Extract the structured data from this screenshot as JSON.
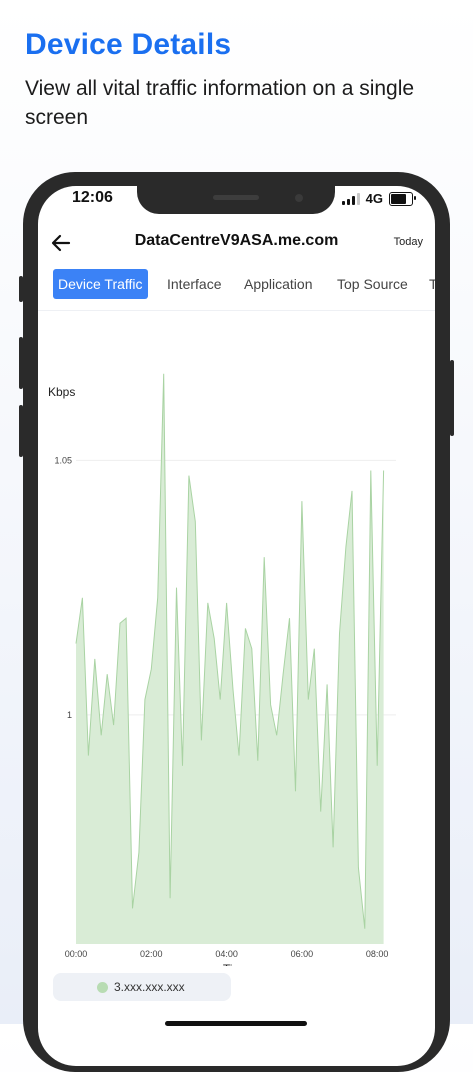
{
  "headline": "Device Details",
  "subhead": "View all vital traffic information on a single screen",
  "status": {
    "time": "12:06",
    "network": "4G"
  },
  "header": {
    "title": "DataCentreV9ASA.me.com",
    "range": "Today"
  },
  "tabs": [
    {
      "label": "Device Traffic",
      "active": true
    },
    {
      "label": "Interface"
    },
    {
      "label": "Application"
    },
    {
      "label": "Top Source"
    },
    {
      "label": "T"
    }
  ],
  "colors": {
    "accent": "#1a6ff0",
    "tab_active": "#3b82f6",
    "area_fill": "#d9ecd6",
    "area_stroke": "#a9d3a3"
  },
  "chart_data": {
    "type": "area",
    "ylabel": "Kbps",
    "xlabel": "Time",
    "x_ticks": [
      "00:00",
      "02:00",
      "04:00",
      "06:00",
      "08:00"
    ],
    "y_ticks": [
      1,
      1.05
    ],
    "y_tick_labels": [
      "1",
      "1.05"
    ],
    "ylim": [
      0.955,
      1.065
    ],
    "xlim": [
      0,
      8.5
    ],
    "grid": "horizontal",
    "series": [
      {
        "name": "3.xxx.xxx.xxx",
        "x": [
          0.0,
          0.17,
          0.33,
          0.5,
          0.67,
          0.83,
          1.0,
          1.17,
          1.33,
          1.5,
          1.67,
          1.83,
          2.0,
          2.17,
          2.33,
          2.5,
          2.67,
          2.83,
          3.0,
          3.17,
          3.33,
          3.5,
          3.67,
          3.83,
          4.0,
          4.17,
          4.33,
          4.5,
          4.67,
          4.83,
          5.0,
          5.17,
          5.33,
          5.5,
          5.67,
          5.83,
          6.0,
          6.17,
          6.33,
          6.5,
          6.67,
          6.83,
          7.0,
          7.17,
          7.33,
          7.5,
          7.67,
          7.83,
          8.0,
          8.17
        ],
        "values": [
          1.014,
          1.023,
          0.992,
          1.011,
          0.996,
          1.008,
          0.998,
          1.018,
          1.019,
          0.962,
          0.973,
          1.003,
          1.009,
          1.023,
          1.067,
          0.964,
          1.025,
          0.99,
          1.047,
          1.038,
          0.995,
          1.022,
          1.015,
          1.003,
          1.022,
          1.005,
          0.992,
          1.017,
          1.013,
          0.991,
          1.031,
          1.002,
          0.996,
          1.008,
          1.019,
          0.985,
          1.042,
          1.003,
          1.013,
          0.981,
          1.006,
          0.974,
          1.016,
          1.033,
          1.044,
          0.97,
          0.958,
          1.048,
          0.99,
          1.048
        ]
      }
    ]
  }
}
